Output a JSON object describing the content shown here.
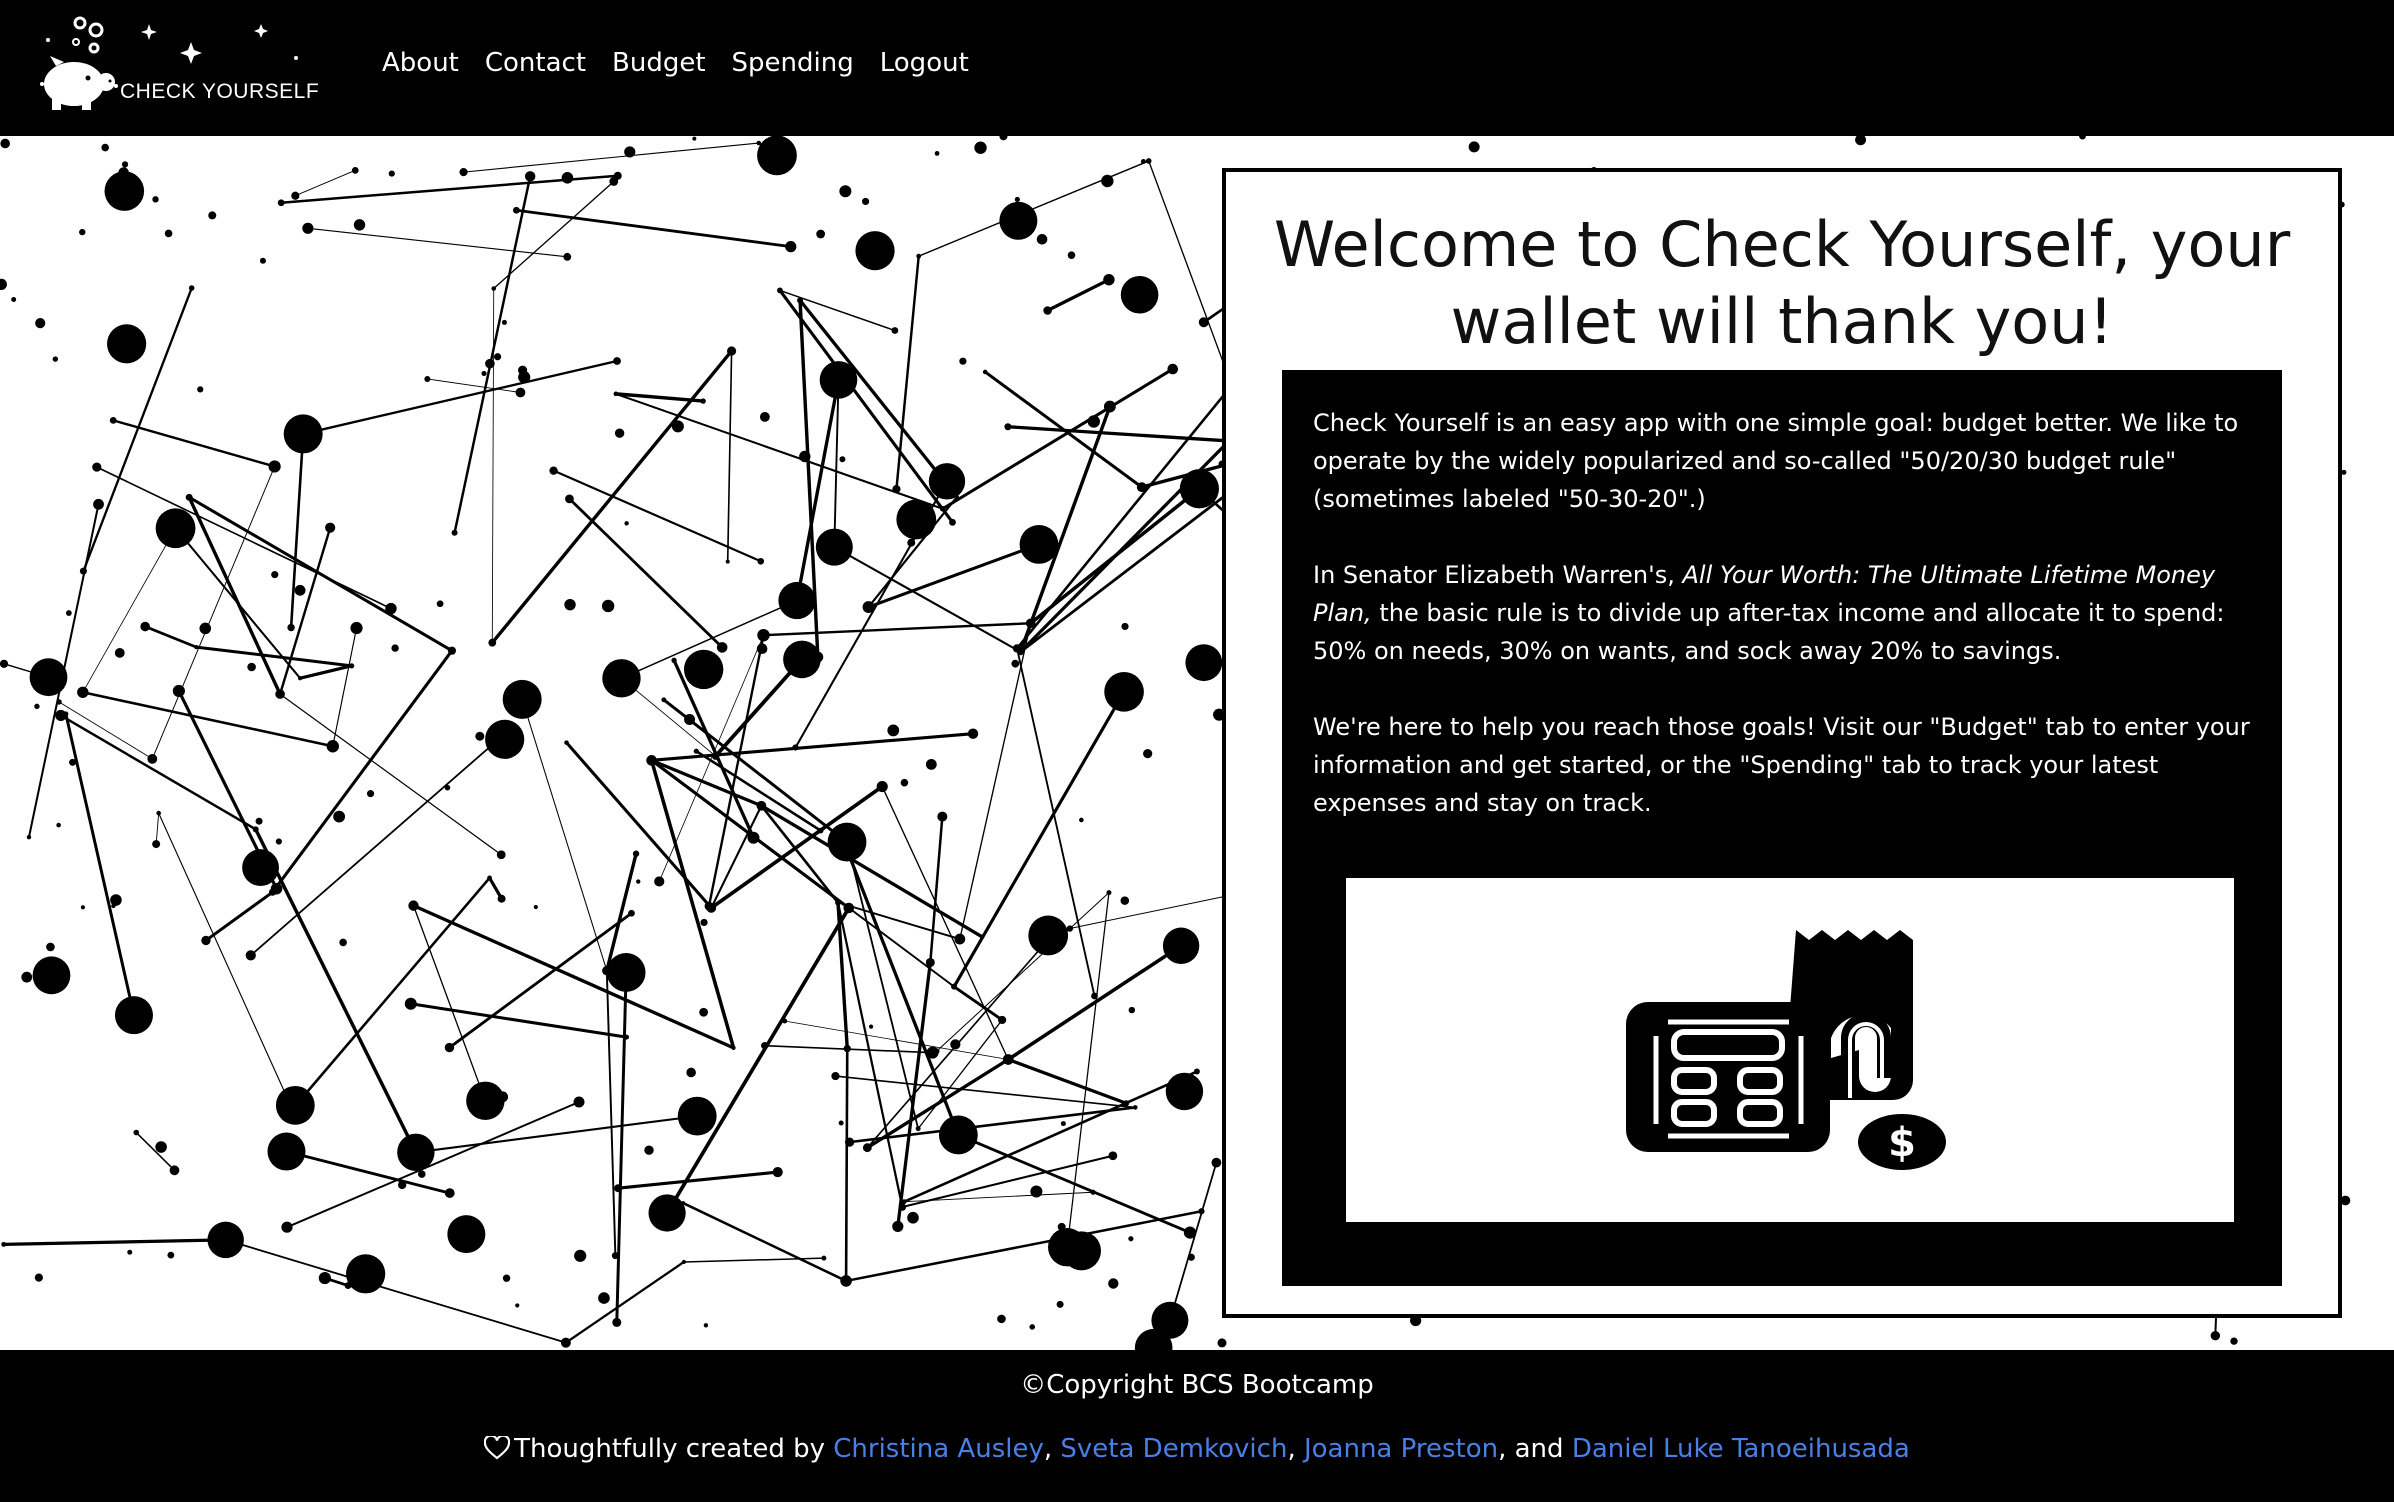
{
  "nav": {
    "brand_text": "CHECK YOURSELF",
    "links": [
      "About",
      "Contact",
      "Budget",
      "Spending",
      "Logout"
    ]
  },
  "welcome": {
    "title": "Welcome to Check Yourself, your wallet will thank you!",
    "p1": "Check Yourself is an easy app with one simple goal: budget better. We like to operate by the widely popularized and so-called \"50/20/30 budget rule\" (sometimes labeled \"50-30-20\".)",
    "p2_before": "In Senator Elizabeth Warren's, ",
    "p2_italic": "All Your Worth: The Ultimate Lifetime Money Plan,",
    "p2_after": " the basic rule is to divide up after-tax income and allocate it to spend: 50% on needs, 30% on wants, and sock away 20% to savings.",
    "p3": "We're here to help you reach those goals! Visit our \"Budget\" tab to enter your information and get started, or the \"Spending\" tab to track your latest expenses and stay on track."
  },
  "footer": {
    "copyright": "©Copyright BCS Bootcamp",
    "credits_prefix": "Thoughtfully created by ",
    "authors": [
      "Christina Ausley",
      "Sveta Demkovich",
      "Joanna Preston",
      "Daniel Luke Tanoeihusada"
    ],
    "sep1": ", ",
    "sep2": ", ",
    "sep3": ", and "
  },
  "colors": {
    "nav_bg": "#000000",
    "footer_link": "#4a7fe6",
    "panel_bg": "#000000"
  },
  "icons": {
    "logo": "piggy-bank-icon",
    "illustration": "calculator-receipt-dollar-icon",
    "heart": "heart-outline-icon"
  }
}
